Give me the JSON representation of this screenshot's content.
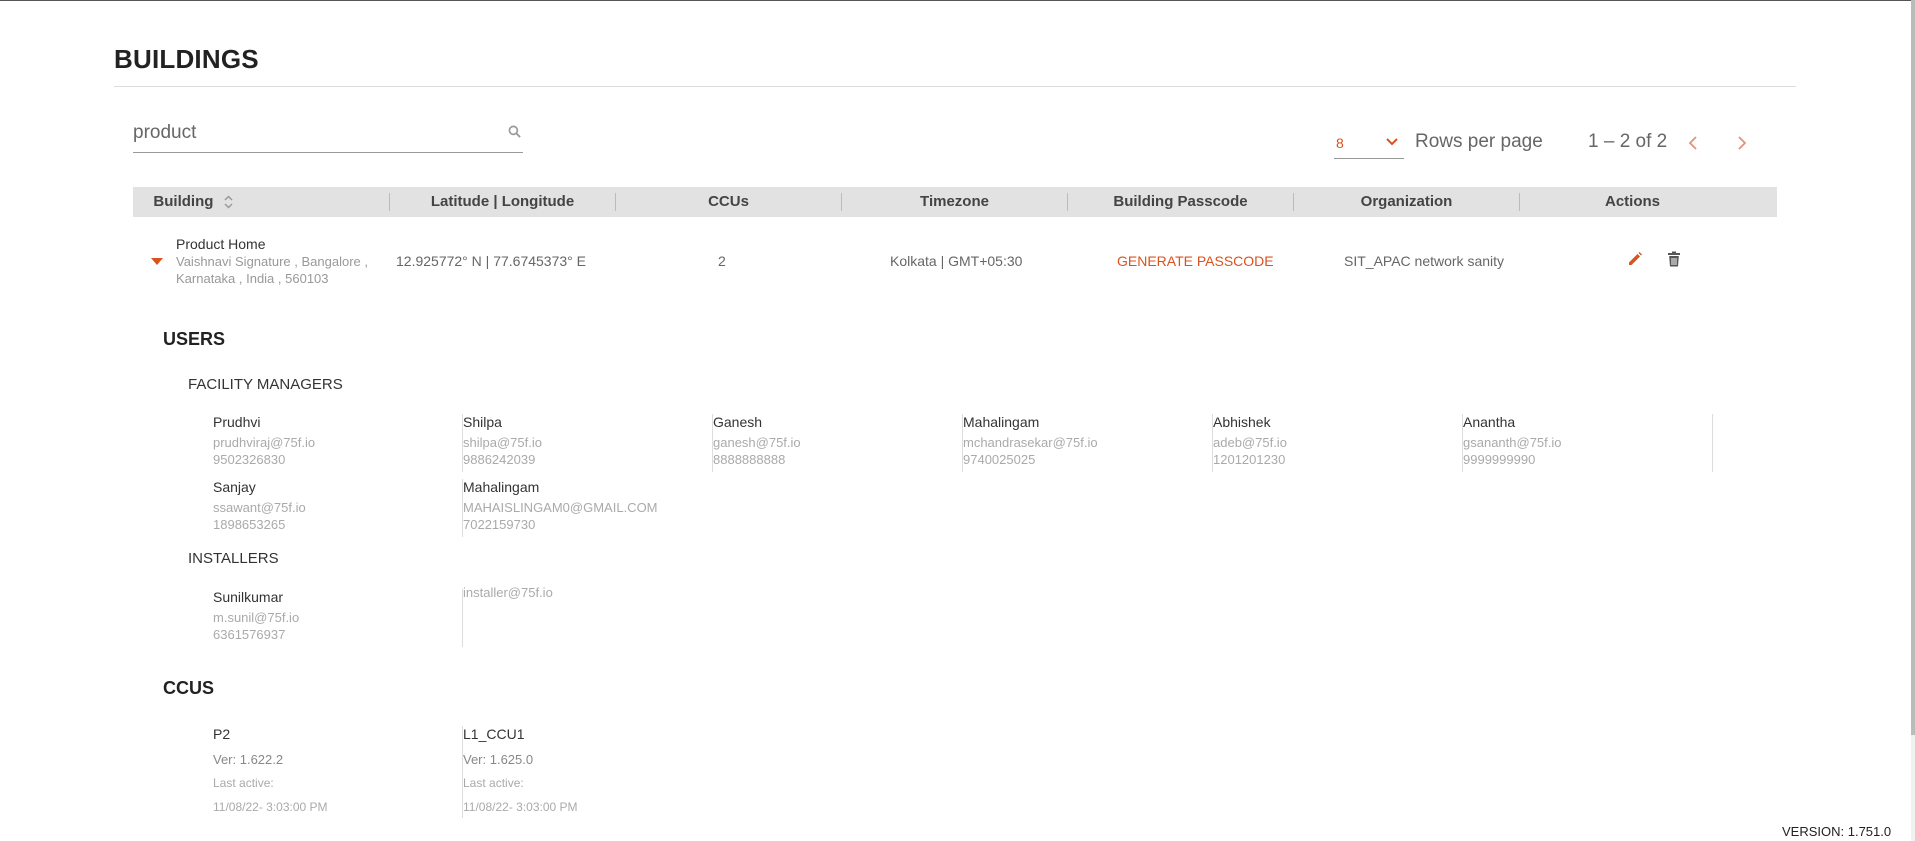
{
  "page": {
    "title": "BUILDINGS"
  },
  "search": {
    "value": "product"
  },
  "pagination": {
    "rows_value": "8",
    "rows_label": "Rows per page",
    "range": "1 – 2 of 2"
  },
  "table": {
    "headers": [
      "Building",
      "Latitude | Longitude",
      "CCUs",
      "Timezone",
      "Building Passcode",
      "Organization",
      "Actions"
    ]
  },
  "building": {
    "name": "Product Home",
    "address": "Vaishnavi Signature , Bangalore , Karnataka , India , 560103",
    "coords": "12.925772° N | 77.6745373° E",
    "ccus": "2",
    "timezone": "Kolkata | GMT+05:30",
    "passcode_action": "GENERATE PASSCODE",
    "organization": "SIT_APAC network sanity"
  },
  "users": {
    "heading": "USERS",
    "facility_heading": "FACILITY MANAGERS",
    "facility_managers": [
      {
        "name": "Prudhvi",
        "email": "prudhviraj@75f.io",
        "phone": "9502326830"
      },
      {
        "name": "Shilpa",
        "email": "shilpa@75f.io",
        "phone": "9886242039"
      },
      {
        "name": "Ganesh",
        "email": "ganesh@75f.io",
        "phone": "8888888888"
      },
      {
        "name": "Mahalingam",
        "email": "mchandrasekar@75f.io",
        "phone": "9740025025"
      },
      {
        "name": "Abhishek",
        "email": "adeb@75f.io",
        "phone": "1201201230"
      },
      {
        "name": "Anantha",
        "email": "gsananth@75f.io",
        "phone": "9999999990"
      },
      {
        "name": "Sanjay",
        "email": "ssawant@75f.io",
        "phone": "1898653265"
      },
      {
        "name": "Mahalingam",
        "email": "MAHAISLINGAM0@GMAIL.COM",
        "phone": "7022159730"
      }
    ],
    "installers_heading": "INSTALLERS",
    "installers": [
      {
        "name": "Sunilkumar",
        "email": "m.sunil@75f.io",
        "phone": "6361576937"
      },
      {
        "name": "",
        "email": "installer@75f.io",
        "phone": ""
      }
    ]
  },
  "ccus": {
    "heading": "CCUS",
    "items": [
      {
        "name": "P2",
        "version": "Ver: 1.622.2",
        "last_active_label": "Last active:",
        "last_active": "11/08/22- 3:03:00 PM"
      },
      {
        "name": "L1_CCU1",
        "version": "Ver: 1.625.0",
        "last_active_label": "Last active:",
        "last_active": "11/08/22- 3:03:00 PM"
      }
    ]
  },
  "footer": {
    "version": "VERSION: 1.751.0"
  },
  "colors": {
    "accent": "#d9531e",
    "header_bg": "#e2e2e2"
  },
  "icons": [
    "search-icon",
    "chevron-down-icon",
    "chevron-left-icon",
    "chevron-right-icon",
    "sort-icon",
    "caret-down-icon",
    "pencil-icon",
    "trash-icon"
  ]
}
